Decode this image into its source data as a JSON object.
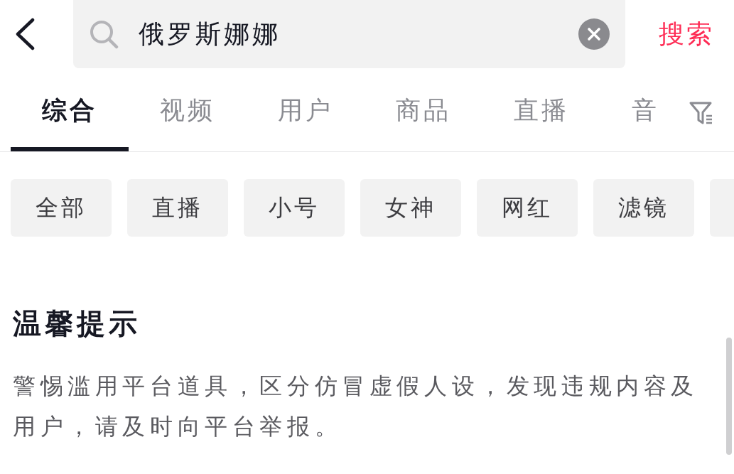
{
  "search": {
    "value": "俄罗斯娜娜"
  },
  "search_button": "搜索",
  "tabs": [
    {
      "label": "综合",
      "selected": true
    },
    {
      "label": "视频",
      "selected": false
    },
    {
      "label": "用户",
      "selected": false
    },
    {
      "label": "商品",
      "selected": false
    },
    {
      "label": "直播",
      "selected": false
    },
    {
      "label": "音",
      "selected": false
    }
  ],
  "chips": [
    {
      "kind": "tag",
      "label": "全部"
    },
    {
      "kind": "tag",
      "label": "直播"
    },
    {
      "kind": "tag",
      "label": "小号"
    },
    {
      "kind": "tag",
      "label": "女神"
    },
    {
      "kind": "tag",
      "label": "网红"
    },
    {
      "kind": "tag",
      "label": "滤镜"
    },
    {
      "kind": "clipped"
    }
  ],
  "notice": {
    "title": "温馨提示",
    "text": "警惕滥用平台道具，区分仿冒虚假人设，发现违规内容及用户，请及时向平台举报。"
  }
}
